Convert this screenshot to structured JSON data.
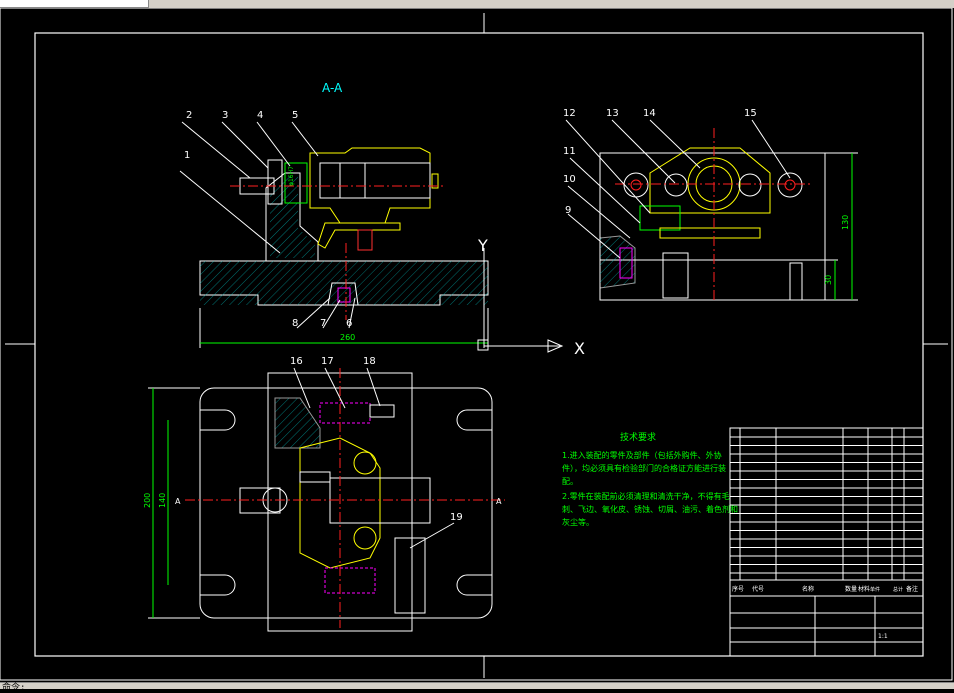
{
  "app": {
    "command_line": "命令:"
  },
  "section_label": "A-A",
  "axis": {
    "y_label": "Y",
    "x_label": "X"
  },
  "balloons": {
    "front": [
      "2",
      "3",
      "4",
      "5",
      "1",
      "8",
      "7",
      "6"
    ],
    "side": [
      "12",
      "13",
      "14",
      "15",
      "11",
      "10",
      "9"
    ],
    "plan": [
      "16",
      "17",
      "18",
      "19"
    ]
  },
  "dimensions": {
    "front_width": "260",
    "side_height": "130",
    "side_base": "30",
    "plan_height": "200",
    "plan_inner": "140"
  },
  "section_markers": [
    "A",
    "A"
  ],
  "notes": {
    "title": "技术要求",
    "line1": "1.进入装配的零件及部件（包括外购件、外协",
    "line2": "件），均必须具有检验部门的合格证方能进行装",
    "line3": "配。",
    "line4": "2.零件在装配前必须清理和清洗干净，不得有毛",
    "line5": "刺、飞边、氧化皮、锈蚀、切屑、油污、着色剂和",
    "line6": "灰尘等。"
  },
  "title_block": {
    "headers": [
      "序号",
      "代号",
      "名称",
      "数量",
      "材料",
      "单件",
      "总计",
      "备注"
    ],
    "scale": "1:1"
  },
  "colors": {
    "background": "#000000",
    "outline": "#ffffff",
    "hatch": "#00c8c8",
    "centerline": "#ff2020",
    "dimension": "#00ff00",
    "part": "#ffff00",
    "highlight": "#ff00ff",
    "leader": "#ffffff"
  }
}
